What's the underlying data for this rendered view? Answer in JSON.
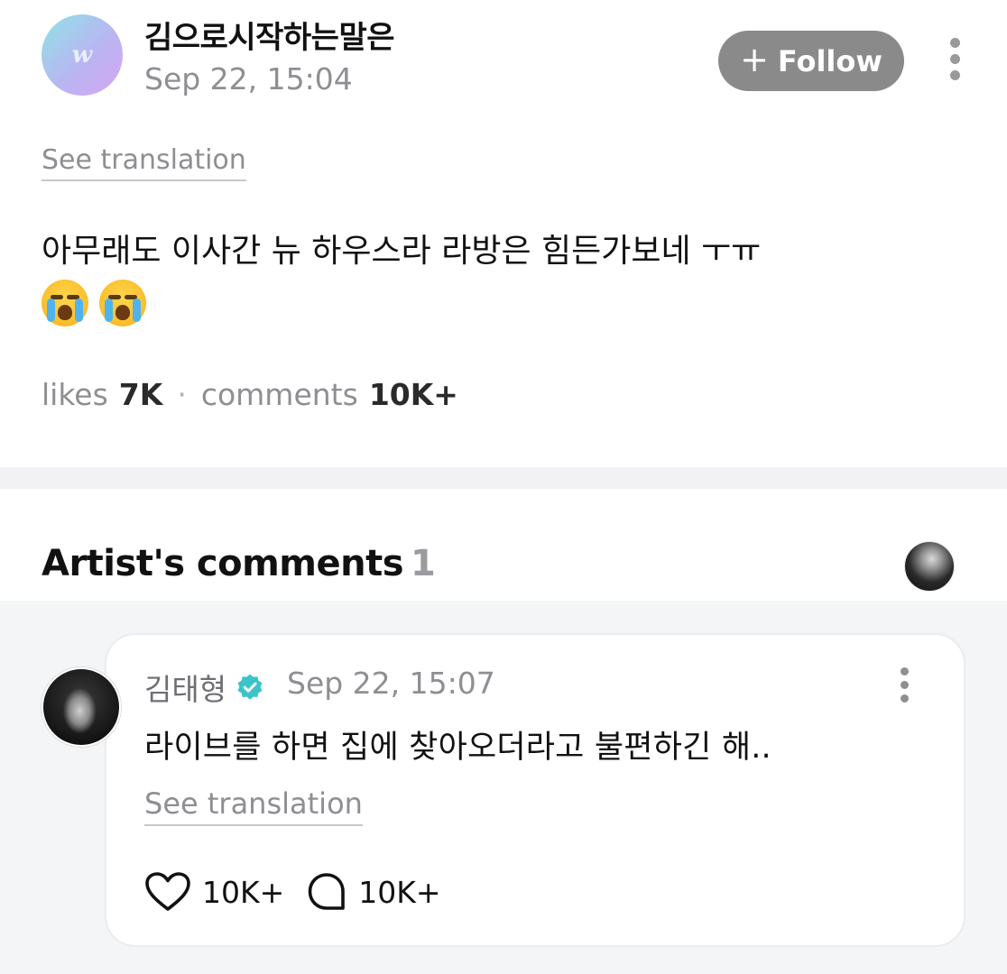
{
  "post": {
    "author_name": "김으로시작하는말은",
    "date": "Sep 22, 15:04",
    "avatar_logo": "w",
    "follow_label": "Follow",
    "follow_icon": "+",
    "see_translation": "See translation",
    "body_text": "아무래도 이사간 뉴 하우스라 라방은 힘든가보네 ㅜㅠ",
    "emojis": [
      "loudly-crying-face",
      "loudly-crying-face"
    ],
    "stats": {
      "likes_label": "likes",
      "likes_value": "7K",
      "separator": "·",
      "comments_label": "comments",
      "comments_value": "10K+"
    }
  },
  "artist_comments": {
    "title": "Artist's comments",
    "count": "1"
  },
  "comment": {
    "author_name": "김태형",
    "verified": true,
    "date": "Sep 22, 15:07",
    "text": "라이브를 하면 집에 찾아오더라고 불편하긴 해..",
    "see_translation": "See translation",
    "likes": "10K+",
    "replies": "10K+"
  },
  "colors": {
    "follow_button": "#8a8a8a",
    "muted_text": "#8e8e93",
    "verified_badge": "#3cc3c8",
    "comment_area_bg": "#f4f5f7"
  }
}
